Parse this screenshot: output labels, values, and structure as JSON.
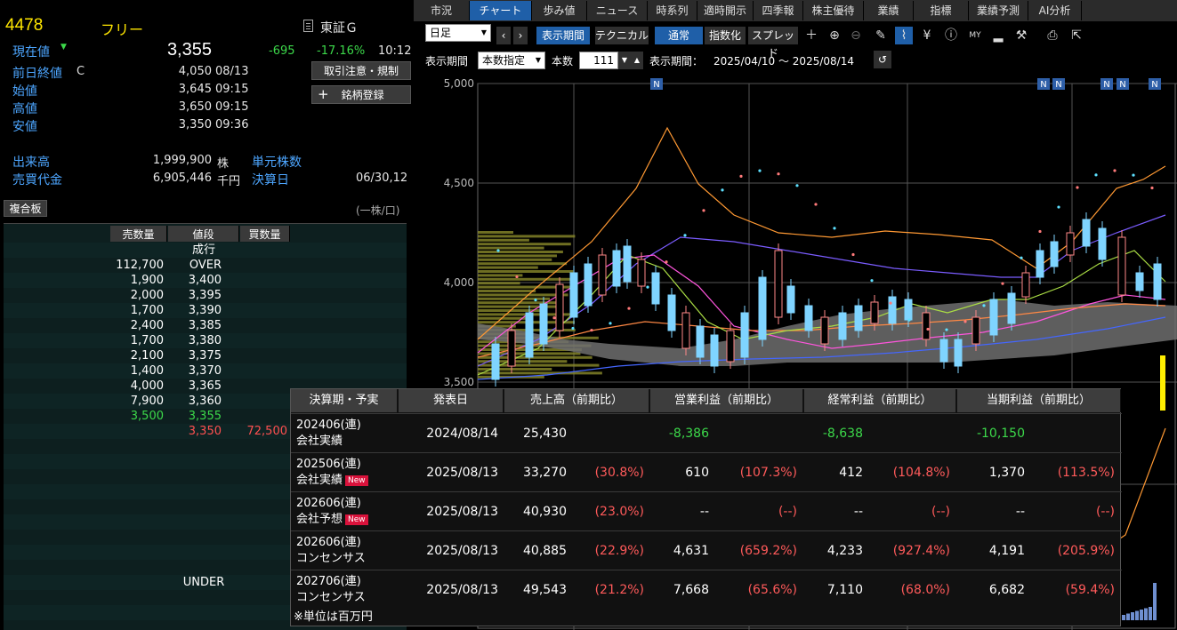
{
  "stock": {
    "code": "4478",
    "name": "フリー",
    "exchange": "東証Ｇ",
    "current_label": "現在値",
    "current_price": "3,355",
    "change": "-695",
    "change_pct": "-17.16%",
    "time": "10:12",
    "prev_close_label": "前日終値",
    "prev_close_flag": "C",
    "prev_close": "4,050",
    "prev_close_date": "08/13",
    "open_label": "始値",
    "open": "3,645",
    "open_time": "09:15",
    "high_label": "高値",
    "high": "3,650",
    "high_time": "09:15",
    "low_label": "安値",
    "low": "3,350",
    "low_time": "09:36",
    "volume_label": "出来高",
    "volume": "1,999,900",
    "volume_unit": "株",
    "unit_shares_label": "単元株数",
    "turnover_label": "売買代金",
    "turnover": "6,905,446",
    "turnover_unit": "千円",
    "settlement_label": "決算日",
    "settlement": "06/30,12",
    "notice_button": "取引注意・規制",
    "register_button": "銘柄登録"
  },
  "board": {
    "tab": "複合板",
    "unit_note": "(一株/口)",
    "headers": [
      "売数量",
      "値段",
      "買数量"
    ],
    "market_label": "成行",
    "rows": [
      {
        "sell": "112,700",
        "price": "OVER",
        "buy": ""
      },
      {
        "sell": "1,900",
        "price": "3,400",
        "buy": ""
      },
      {
        "sell": "2,000",
        "price": "3,395",
        "buy": ""
      },
      {
        "sell": "1,700",
        "price": "3,390",
        "buy": ""
      },
      {
        "sell": "2,400",
        "price": "3,385",
        "buy": ""
      },
      {
        "sell": "1,700",
        "price": "3,380",
        "buy": ""
      },
      {
        "sell": "2,100",
        "price": "3,375",
        "buy": ""
      },
      {
        "sell": "1,400",
        "price": "3,370",
        "buy": ""
      },
      {
        "sell": "4,000",
        "price": "3,365",
        "buy": ""
      },
      {
        "sell": "7,900",
        "price": "3,360",
        "buy": ""
      },
      {
        "sell": "3,500",
        "price": "3,355",
        "buy": ""
      },
      {
        "sell": "",
        "price": "3,350",
        "buy": "72,500"
      }
    ],
    "under_label": "UNDER"
  },
  "tabs": [
    "市況",
    "チャート",
    "歩み値",
    "ニュース",
    "時系列",
    "適時開示",
    "四季報",
    "株主優待",
    "業績",
    "指標",
    "業績予測",
    "AI分析"
  ],
  "active_tab": "チャート",
  "toolbar": {
    "period_select": "日足",
    "display_period": "表示期間",
    "technical": "テクニカル",
    "normal": "通常",
    "index": "指数化",
    "spread": "スプレッド"
  },
  "toolbar2": {
    "period_label": "表示期間",
    "count_mode": "本数指定",
    "count_label": "本数",
    "count_value": "111",
    "range_label": "表示期間：",
    "range": "2025/04/10 ～ 2025/08/14"
  },
  "chart_data": {
    "type": "candlestick",
    "yticks": [
      "5,000",
      "4,500",
      "4,000",
      "3,500"
    ],
    "ylim": [
      3500,
      5000
    ],
    "news_marker": "N",
    "news_count": 6
  },
  "financials": {
    "headers": [
      "決算期・予実",
      "発表日",
      "売上高（前期比）",
      "営業利益（前期比）",
      "経常利益（前期比）",
      "当期利益（前期比）"
    ],
    "new_badge": "New",
    "rows": [
      {
        "period": "202406(連)",
        "kind": "会社実績",
        "new": false,
        "date": "2024/08/14",
        "sales": "25,430",
        "sales_pct": "",
        "op": "-8,386",
        "op_pct": "",
        "ord": "-8,638",
        "ord_pct": "",
        "net": "-10,150",
        "net_pct": ""
      },
      {
        "period": "202506(連)",
        "kind": "会社実績",
        "new": true,
        "date": "2025/08/13",
        "sales": "33,270",
        "sales_pct": "(30.8%)",
        "op": "610",
        "op_pct": "(107.3%)",
        "ord": "412",
        "ord_pct": "(104.8%)",
        "net": "1,370",
        "net_pct": "(113.5%)"
      },
      {
        "period": "202606(連)",
        "kind": "会社予想",
        "new": true,
        "date": "2025/08/13",
        "sales": "40,930",
        "sales_pct": "(23.0%)",
        "op": "--",
        "op_pct": "(--)",
        "ord": "--",
        "ord_pct": "(--)",
        "net": "--",
        "net_pct": "(--)"
      },
      {
        "period": "202606(連)",
        "kind": "コンセンサス",
        "new": false,
        "date": "2025/08/13",
        "sales": "40,885",
        "sales_pct": "(22.9%)",
        "op": "4,631",
        "op_pct": "(659.2%)",
        "ord": "4,233",
        "ord_pct": "(927.4%)",
        "net": "4,191",
        "net_pct": "(205.9%)"
      },
      {
        "period": "202706(連)",
        "kind": "コンセンサス",
        "new": false,
        "date": "2025/08/13",
        "sales": "49,543",
        "sales_pct": "(21.2%)",
        "op": "7,668",
        "op_pct": "(65.6%)",
        "ord": "7,110",
        "ord_pct": "(68.0%)",
        "net": "6,682",
        "net_pct": "(59.4%)"
      }
    ],
    "note": "※単位は百万円"
  }
}
